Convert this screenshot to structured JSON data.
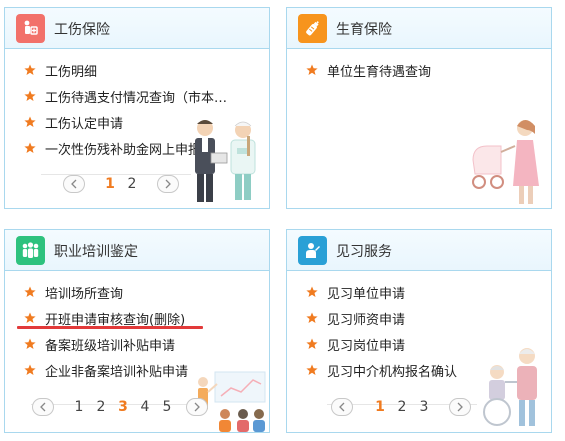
{
  "cards": {
    "injury": {
      "title": "工伤保险",
      "items": [
        "工伤明细",
        "工伤待遇支付情况查询（市本级）",
        "工伤认定申请",
        "一次性伤残补助金网上申报"
      ],
      "pages": [
        "1",
        "2"
      ],
      "active_page": "1"
    },
    "maternity": {
      "title": "生育保险",
      "items": [
        "单位生育待遇查询"
      ]
    },
    "training": {
      "title": "职业培训鉴定",
      "items": [
        "培训场所查询",
        "开班申请审核查询(删除)",
        "备案班级培训补贴申请",
        "企业非备案培训补贴申请"
      ],
      "pages": [
        "1",
        "2",
        "3",
        "4",
        "5"
      ],
      "active_page": "3"
    },
    "internship": {
      "title": "见习服务",
      "items": [
        "见习单位申请",
        "见习师资申请",
        "见习岗位申请",
        "见习中介机构报名确认"
      ],
      "pages": [
        "1",
        "2",
        "3"
      ],
      "active_page": "1"
    }
  },
  "colors": {
    "border": "#a9d8ee",
    "star": "#f07b20",
    "injury_icon": "#f2716a",
    "maternity_icon": "#f7941d",
    "training_icon": "#2ec27e",
    "internship_icon": "#2aa0d6",
    "highlight_underline": "#e23a3a"
  },
  "icons": {
    "list_bullet": "star-icon",
    "injury": "injured-person-icon",
    "maternity": "baby-bottle-icon",
    "training": "group-people-icon",
    "internship": "trainee-icon",
    "prev": "chevron-left-icon",
    "next": "chevron-right-icon"
  }
}
